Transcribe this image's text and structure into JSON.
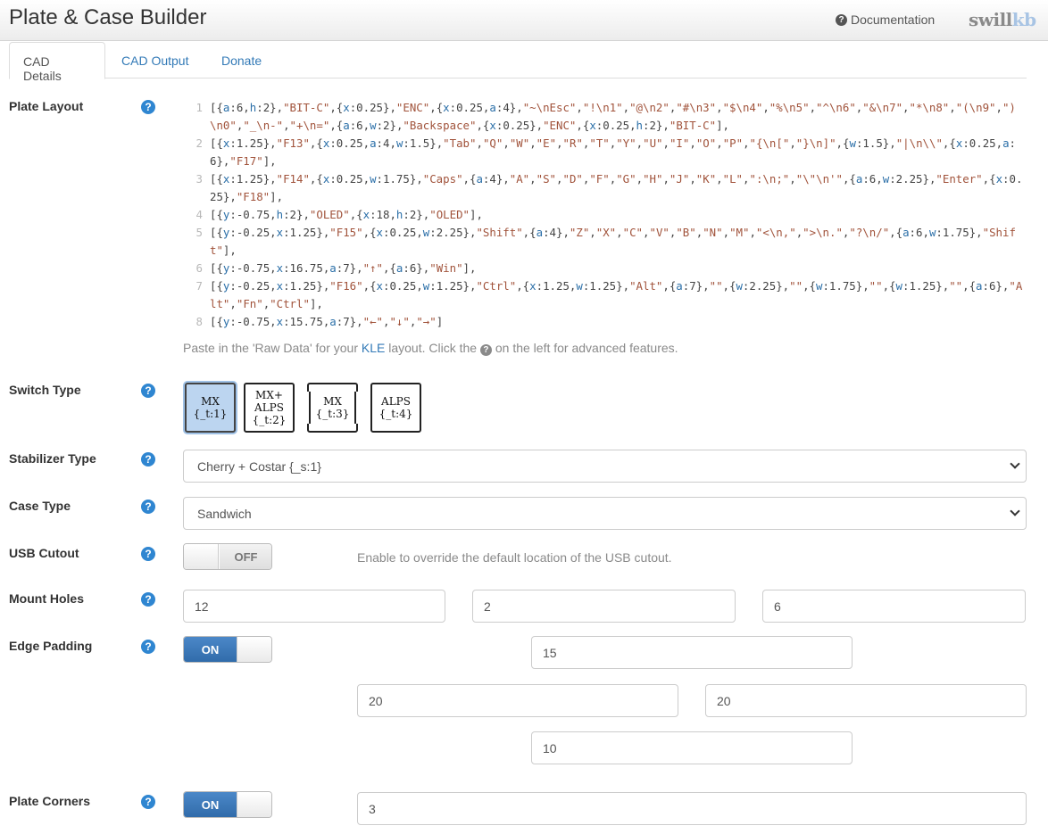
{
  "header": {
    "title": "Plate & Case Builder",
    "documentation_label": "Documentation",
    "logo": {
      "swill": "swill",
      "kb": "kb"
    }
  },
  "tabs": [
    {
      "label": "CAD Details",
      "active": true
    },
    {
      "label": "CAD Output",
      "active": false
    },
    {
      "label": "Donate",
      "active": false
    }
  ],
  "plate_layout": {
    "label": "Plate Layout",
    "lines": [
      "[{a:6,h:2},\"BIT-C\",{x:0.25},\"ENC\",{x:0.25,a:4},\"~\\nEsc\",\"!\\n1\",\"@\\n2\",\"#\\n3\",\"$\\n4\",\"%\\n5\",\"^\\n6\",\"&\\n7\",\"*\\n8\",\"(\\n9\",\")\\n0\",\"_\\n-\",\"+\\n=\",{a:6,w:2},\"Backspace\",{x:0.25},\"ENC\",{x:0.25,h:2},\"BIT-C\"],",
      "[{x:1.25},\"F13\",{x:0.25,a:4,w:1.5},\"Tab\",\"Q\",\"W\",\"E\",\"R\",\"T\",\"Y\",\"U\",\"I\",\"O\",\"P\",\"{\\n[\",\"}\\n]\",{w:1.5},\"|\\n\\\\\",{x:0.25,a:6},\"F17\"],",
      "[{x:1.25},\"F14\",{x:0.25,w:1.75},\"Caps\",{a:4},\"A\",\"S\",\"D\",\"F\",\"G\",\"H\",\"J\",\"K\",\"L\",\":\\n;\",\"\\\"\\n'\",{a:6,w:2.25},\"Enter\",{x:0.25},\"F18\"],",
      "[{y:-0.75,h:2},\"OLED\",{x:18,h:2},\"OLED\"],",
      "[{y:-0.25,x:1.25},\"F15\",{x:0.25,w:2.25},\"Shift\",{a:4},\"Z\",\"X\",\"C\",\"V\",\"B\",\"N\",\"M\",\"<\\n,\",\">\\n.\",\"?\\n/\",{a:6,w:1.75},\"Shift\"],",
      "[{y:-0.75,x:16.75,a:7},\"↑\",{a:6},\"Win\"],",
      "[{y:-0.25,x:1.25},\"F16\",{x:0.25,w:1.25},\"Ctrl\",{x:1.25,w:1.25},\"Alt\",{a:7},\"\",{w:2.25},\"\",{w:1.75},\"\",{w:1.25},\"\",{a:6},\"Alt\",\"Fn\",\"Ctrl\"],",
      "[{y:-0.75,x:15.75,a:7},\"←\",\"↓\",\"→\"]"
    ],
    "help_prefix": "Paste in the 'Raw Data' for your ",
    "help_link": "KLE",
    "help_mid": " layout. Click the ",
    "help_suffix": " on the left for advanced features."
  },
  "switch_type": {
    "label": "Switch Type",
    "options": [
      {
        "line1": "MX",
        "line2": "",
        "line3": "{_t:1}",
        "selected": true
      },
      {
        "line1": "MX+",
        "line2": "ALPS",
        "line3": "{_t:2}",
        "selected": false
      },
      {
        "line1": "MX",
        "line2": "",
        "line3": "{_t:3}",
        "selected": false
      },
      {
        "line1": "ALPS",
        "line2": "",
        "line3": "{_t:4}",
        "selected": false
      }
    ]
  },
  "stabilizer_type": {
    "label": "Stabilizer Type",
    "value": "Cherry + Costar {_s:1}"
  },
  "case_type": {
    "label": "Case Type",
    "value": "Sandwich"
  },
  "usb_cutout": {
    "label": "USB Cutout",
    "state": "OFF",
    "note": "Enable to override the default location of the USB cutout."
  },
  "mount_holes": {
    "label": "Mount Holes",
    "values": [
      "12",
      "2",
      "6"
    ]
  },
  "edge_padding": {
    "label": "Edge Padding",
    "state": "ON",
    "top": "15",
    "left": "20",
    "right": "20",
    "bottom": "10"
  },
  "plate_corners": {
    "label": "Plate Corners",
    "state": "ON",
    "value": "3"
  },
  "colors": {
    "accent": "#337ab7",
    "toggle_on": "#3a78b8",
    "help_icon": "#2f86d1",
    "selected_switch": "#bcd5f0"
  }
}
